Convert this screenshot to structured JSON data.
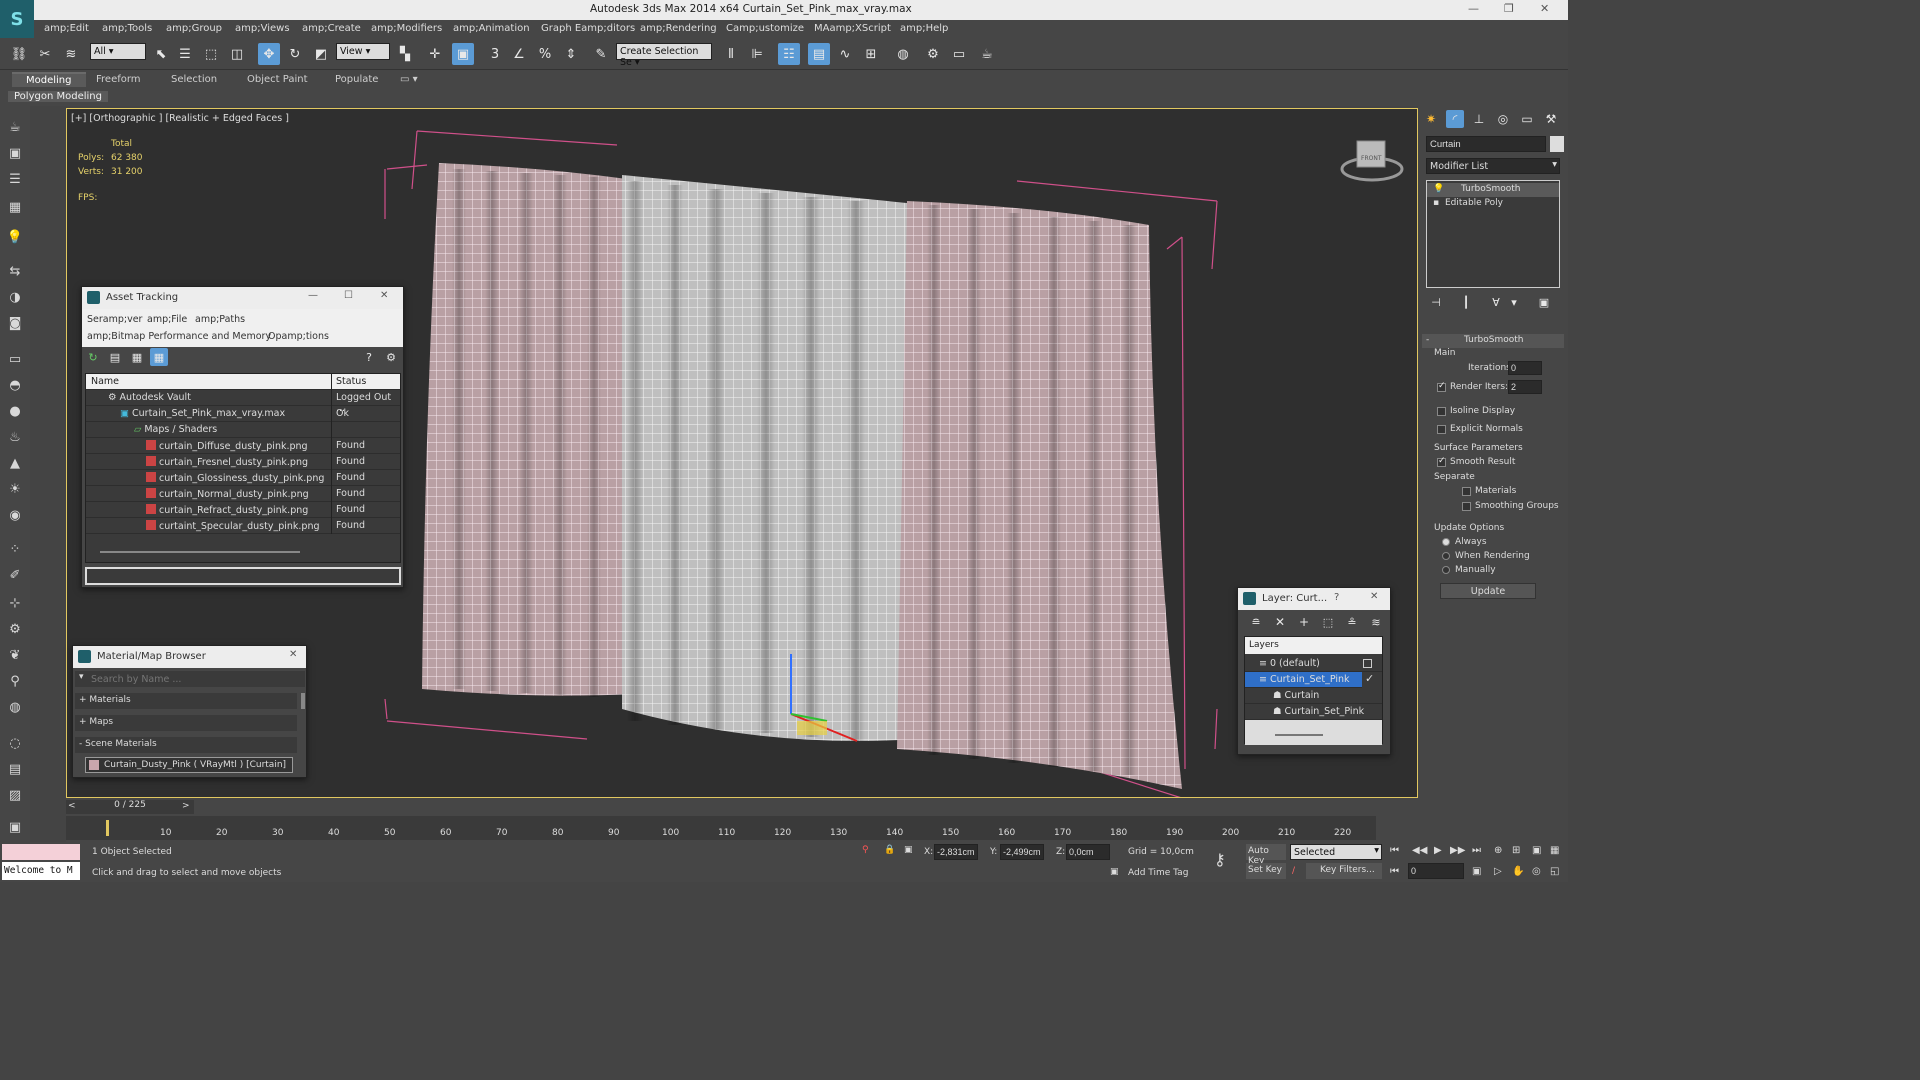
{
  "app": {
    "title": "Autodesk 3ds Max  2014 x64     Curtain_Set_Pink_max_vray.max",
    "logo_letter": "S"
  },
  "menu": [
    "amp;Edit",
    "amp;Tools",
    "amp;Group",
    "amp;Views",
    "amp;Create",
    "amp;Modifiers",
    "amp;Animation",
    "Graph Eamp;ditors",
    "amp;Rendering",
    "Camp;ustomize",
    "MAamp;XScript",
    "amp;Help"
  ],
  "toolbar": {
    "selection_filter": "All",
    "ref_coord": "View",
    "named_selection": "Create Selection Se",
    "snap_label": "3",
    "angle_label": "%"
  },
  "ribbon": {
    "tabs": [
      "Modeling",
      "Freeform",
      "Selection",
      "Object Paint",
      "Populate"
    ],
    "sub": "Polygon Modeling"
  },
  "viewport": {
    "label": "[+] [Orthographic ] [Realistic + Edged Faces ]",
    "stats_total": "Total",
    "polys_label": "Polys:",
    "polys_value": "62 380",
    "verts_label": "Verts:",
    "verts_value": "31 200",
    "fps_label": "FPS:",
    "viewcube_label": "FRONT"
  },
  "asset_tracking": {
    "title": "Asset Tracking",
    "menu1": [
      "Seramp;ver",
      "amp;File",
      "amp;Paths"
    ],
    "menu2": [
      "amp;Bitmap Performance and Memory",
      "Opamp;tions"
    ],
    "col_name": "Name",
    "col_status": "Status",
    "rows": [
      {
        "name": "Autodesk Vault",
        "status": "Logged Out ..."
      },
      {
        "name": "Curtain_Set_Pink_max_vray.max",
        "status": "Ok"
      },
      {
        "name": "Maps / Shaders",
        "status": ""
      },
      {
        "name": "curtain_Diffuse_dusty_pink.png",
        "status": "Found"
      },
      {
        "name": "curtain_Fresnel_dusty_pink.png",
        "status": "Found"
      },
      {
        "name": "curtain_Glossiness_dusty_pink.png",
        "status": "Found"
      },
      {
        "name": "curtain_Normal_dusty_pink.png",
        "status": "Found"
      },
      {
        "name": "curtain_Refract_dusty_pink.png",
        "status": "Found"
      },
      {
        "name": "curtaint_Specular_dusty_pink.png",
        "status": "Found"
      }
    ]
  },
  "material_browser": {
    "title": "Material/Map Browser",
    "search_placeholder": "Search by Name ...",
    "sections": [
      "+ Materials",
      "+ Maps",
      "- Scene Materials"
    ],
    "scene_material": "Curtain_Dusty_Pink  ( VRayMtl )  [Curtain]"
  },
  "layer_window": {
    "title": "Layer: Curt...",
    "help": "?",
    "header": "Layers",
    "items": [
      "0 (default)",
      "Curtain_Set_Pink",
      "Curtain",
      "Curtain_Set_Pink"
    ]
  },
  "command_panel": {
    "object_name": "Curtain",
    "modifier_list": "Modifier List",
    "stack": [
      "TurboSmooth",
      "Editable Poly"
    ],
    "rollout": "TurboSmooth",
    "main": "Main",
    "iterations_label": "Iterations:",
    "iterations": "0",
    "render_iters_label": "Render Iters:",
    "render_iters": "2",
    "isoline": "Isoline Display",
    "explicit": "Explicit Normals",
    "surface": "Surface Parameters",
    "smooth_result": "Smooth Result",
    "separate": "Separate",
    "materials": "Materials",
    "smoothing": "Smoothing Groups",
    "update_options": "Update Options",
    "always": "Always",
    "when_rendering": "When Rendering",
    "manually": "Manually",
    "update_btn": "Update"
  },
  "timeline": {
    "frame": "0 / 225",
    "ticks": [
      "10",
      "20",
      "30",
      "40",
      "50",
      "60",
      "70",
      "80",
      "90",
      "100",
      "110",
      "120",
      "130",
      "140",
      "150",
      "160",
      "170",
      "180",
      "190",
      "200",
      "210",
      "220"
    ]
  },
  "status": {
    "selected": "1 Object Selected",
    "prompt": "Click and drag to select and move objects",
    "welcome": "Welcome to M",
    "x_label": "X:",
    "x": "-2,831cm",
    "y_label": "Y:",
    "y": "-2,499cm",
    "z_label": "Z:",
    "z": "0,0cm",
    "grid": "Grid = 10,0cm",
    "add_time_tag": "Add Time Tag",
    "auto_key": "Auto Key",
    "set_key": "Set Key",
    "key_mode": "Selected",
    "key_filters": "Key Filters...",
    "frame_field": "0"
  },
  "colors": {
    "accent": "#5b9bd5",
    "selection": "#e2c860",
    "bbox": "#d0508a"
  }
}
